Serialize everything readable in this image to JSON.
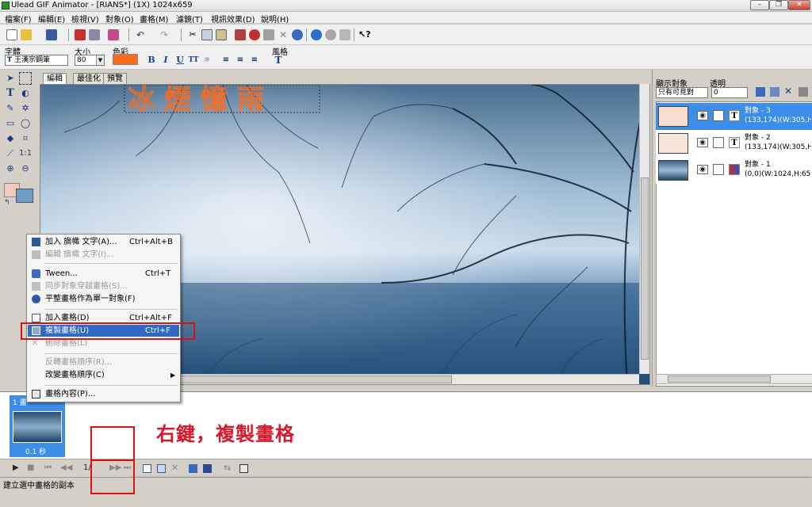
{
  "window": {
    "title": "Ulead GIF Animator - [RIANS*] (1X) 1024x659"
  },
  "menu": [
    "檔案(F)",
    "編輯(E)",
    "檢視(V)",
    "對象(O)",
    "畫格(M)",
    "濾鏡(T)",
    "視訊效果(D)",
    "說明(H)"
  ],
  "text_toolbar": {
    "font_label": "字體",
    "font_value": "王漢宗鋼筆",
    "size_label": "大小",
    "size_value": "80",
    "color_label": "色彩",
    "style_label": "風格",
    "text_color": "#ff6a1a"
  },
  "tabs": [
    "編輯",
    "最佳化",
    "預覽"
  ],
  "canvas": {
    "text": "冰煙憶雨"
  },
  "object_panel": {
    "show_label": "顯示對象",
    "show_value": "只有可見對",
    "opacity_label": "透明",
    "opacity_value": "0",
    "objects": [
      {
        "name": "對象 - 3",
        "info": "(133,174)(W:305,H:7",
        "selected": true,
        "type": "T"
      },
      {
        "name": "對象 - 2",
        "info": "(133,174)(W:305,H:7",
        "selected": false,
        "type": "T"
      },
      {
        "name": "對象 - 1",
        "info": "(0,0)(W:1024,H:659)",
        "selected": false,
        "type": ""
      }
    ]
  },
  "context_menu": {
    "items": [
      {
        "label": "加入 旗幟 文字(A)...",
        "shortcut": "Ctrl+Alt+B",
        "disabled": false,
        "highlight": false
      },
      {
        "label": "編輯 旗幟 文字(I)...",
        "shortcut": "",
        "disabled": true,
        "highlight": false
      },
      {
        "label": "Tween...",
        "shortcut": "Ctrl+T",
        "disabled": false,
        "highlight": false
      },
      {
        "label": "同步對象穿越畫格(S)...",
        "shortcut": "",
        "disabled": true,
        "highlight": false
      },
      {
        "label": "平整畫格作為單一對象(F)",
        "shortcut": "",
        "disabled": false,
        "highlight": false
      },
      {
        "label": "加入畫格(D)",
        "shortcut": "Ctrl+Alt+F",
        "disabled": false,
        "highlight": false
      },
      {
        "label": "複製畫格(U)",
        "shortcut": "Ctrl+F",
        "disabled": false,
        "highlight": true
      },
      {
        "label": "刪除畫格(L)",
        "shortcut": "",
        "disabled": true,
        "highlight": false
      },
      {
        "label": "反轉畫格順序(R)...",
        "shortcut": "",
        "disabled": true,
        "highlight": false
      },
      {
        "label": "改變畫格順序(C)",
        "shortcut": "",
        "disabled": false,
        "highlight": false
      },
      {
        "label": "畫格內容(P)...",
        "shortcut": "",
        "disabled": false,
        "highlight": false
      }
    ]
  },
  "frame_panel": {
    "frame_label": "1 畫",
    "frame_delay": "0.1 秒",
    "counter": "1/"
  },
  "annotation_text": "右鍵，複製畫格",
  "status_text": "建立選中畫格的副本",
  "colors": {
    "highlight": "#316ac5",
    "selected_object": "#3d8ee8",
    "annotation": "#d8182a"
  }
}
